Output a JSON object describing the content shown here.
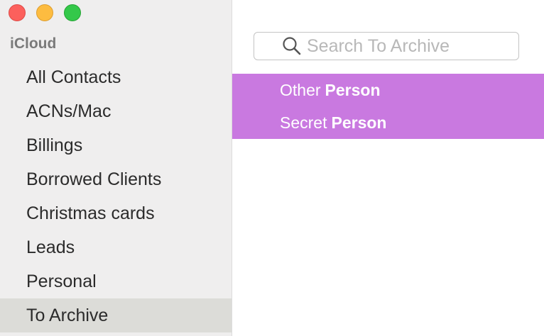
{
  "sidebar": {
    "section_title": "iCloud",
    "groups": [
      {
        "label": "All Contacts"
      },
      {
        "label": "ACNs/Mac"
      },
      {
        "label": "Billings"
      },
      {
        "label": "Borrowed Clients"
      },
      {
        "label": "Christmas cards"
      },
      {
        "label": "Leads"
      },
      {
        "label": "Personal"
      },
      {
        "label": "To Archive"
      }
    ],
    "selected_group": "To Archive"
  },
  "search": {
    "placeholder": "Search To Archive",
    "value": "",
    "icon": "search-icon"
  },
  "contacts": [
    {
      "first_name": "Other",
      "last_name": "Person",
      "selected": true
    },
    {
      "first_name": "Secret",
      "last_name": "Person",
      "selected": true
    }
  ],
  "colors": {
    "selection": "#c979e0",
    "sidebar_bg": "#efeeee",
    "sidebar_selected": "#dcdcd8",
    "close": "#fc605c",
    "minimize": "#fdbc40",
    "zoom": "#34c84a"
  }
}
